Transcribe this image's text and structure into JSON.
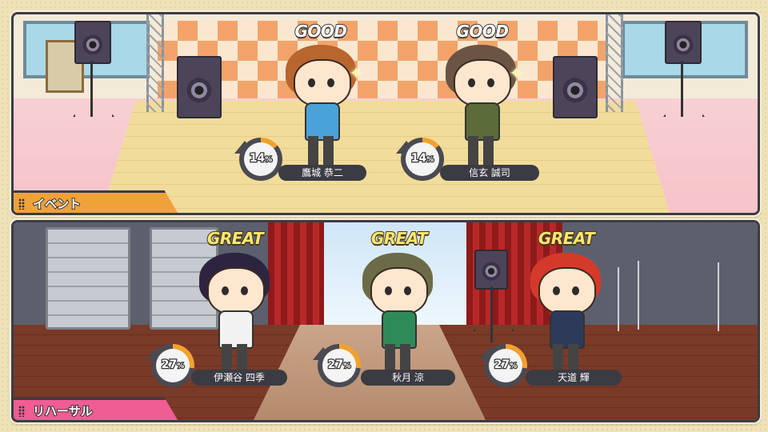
{
  "event_panel": {
    "label": "イベント",
    "label_color": "#f0a23a",
    "performers": [
      {
        "name": "鷹城 恭二",
        "rating": "GOOD",
        "tension_percent": 14,
        "tension_label": "14",
        "hair_color": "#b8652e",
        "outfit_color": "#4aa3d8"
      },
      {
        "name": "信玄 誠司",
        "rating": "GOOD",
        "tension_percent": 14,
        "tension_label": "14",
        "hair_color": "#6b5443",
        "outfit_color": "#5b6b3a"
      }
    ]
  },
  "rehearsal_panel": {
    "label": "リハーサル",
    "label_color": "#ef5d93",
    "performers": [
      {
        "name": "伊瀬谷 四季",
        "rating": "GREAT",
        "tension_percent": 27,
        "tension_label": "27",
        "hair_color": "#2d2540",
        "outfit_color": "#f2f2f2"
      },
      {
        "name": "秋月 涼",
        "rating": "GREAT",
        "tension_percent": 27,
        "tension_label": "27",
        "hair_color": "#6b6b48",
        "outfit_color": "#2f8a5a"
      },
      {
        "name": "天道 輝",
        "rating": "GREAT",
        "tension_percent": 27,
        "tension_label": "27",
        "hair_color": "#d43a2a",
        "outfit_color": "#2e3a5a"
      }
    ]
  },
  "percent_sign": "%",
  "gauge_fill_color": "#f2a12e"
}
